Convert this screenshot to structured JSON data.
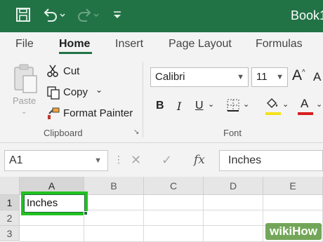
{
  "titlebar": {
    "title": "Book1",
    "save_icon": "save-icon",
    "undo_icon": "undo-icon",
    "redo_icon": "redo-icon",
    "customize_icon": "customize-qat-icon"
  },
  "tabs": [
    {
      "label": "File"
    },
    {
      "label": "Home",
      "active": true
    },
    {
      "label": "Insert"
    },
    {
      "label": "Page Layout"
    },
    {
      "label": "Formulas"
    }
  ],
  "clipboard": {
    "paste": "Paste",
    "cut": "Cut",
    "copy": "Copy",
    "format_painter": "Format Painter",
    "label": "Clipboard"
  },
  "font": {
    "name": "Calibri",
    "size": "11",
    "grow": "A",
    "shrink": "A",
    "bold": "B",
    "italic": "I",
    "underline": "U",
    "font_color_letter": "A",
    "label": "Font",
    "highlight_color": "#f5e21b",
    "font_color": "#d81e1e"
  },
  "formula_bar": {
    "name_box": "A1",
    "fx": "fx",
    "value": "Inches"
  },
  "grid": {
    "columns": [
      "A",
      "B",
      "C",
      "D",
      "E"
    ],
    "rows": [
      "1",
      "2",
      "3"
    ],
    "a1_value": "Inches"
  },
  "watermark": "wikiHow",
  "colors": {
    "accent": "#217346",
    "selection": "#21c21f"
  }
}
